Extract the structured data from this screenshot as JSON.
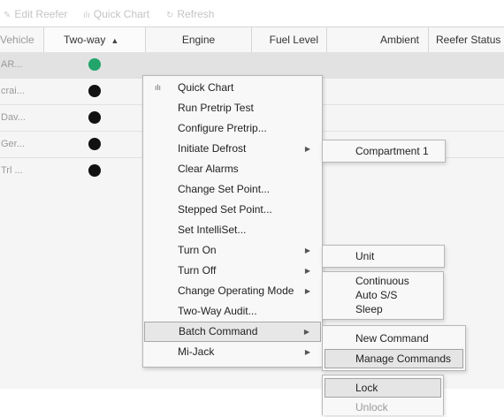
{
  "toolbar": {
    "edit_reefer": "Edit Reefer",
    "quick_chart": "Quick Chart",
    "refresh": "Refresh"
  },
  "columns": {
    "vehicle": "Vehicle",
    "two_way": "Two-way",
    "engine": "Engine",
    "fuel_level": "Fuel Level",
    "ambient": "Ambient",
    "reefer_status": "Reefer Status"
  },
  "rows": [
    {
      "name": "AR...",
      "status": "green"
    },
    {
      "name": "crai...",
      "status": "black"
    },
    {
      "name": "Dav...",
      "status": "black"
    },
    {
      "name": "Ger...",
      "status": "black"
    },
    {
      "name": "Trl ...",
      "status": "black"
    }
  ],
  "context_menu": {
    "items": [
      "Quick Chart",
      "Run Pretrip Test",
      "Configure Pretrip...",
      "Initiate Defrost",
      "Clear Alarms",
      "Change Set Point...",
      "Stepped Set Point...",
      "Set IntelliSet...",
      "Turn On",
      "Turn Off",
      "Change Operating Mode",
      "Two-Way Audit...",
      "Batch Command",
      "Mi-Jack"
    ]
  },
  "submenus": {
    "defrost": [
      "Compartment 1"
    ],
    "turn_on": [
      "Unit"
    ],
    "operating_mode": [
      "Continuous",
      "Auto S/S",
      "Sleep"
    ],
    "batch_command": [
      "New Command",
      "Manage Commands"
    ],
    "lock": [
      "Lock",
      "Unlock"
    ]
  },
  "colors": {
    "status_green": "#22a46a",
    "status_black": "#111111"
  }
}
